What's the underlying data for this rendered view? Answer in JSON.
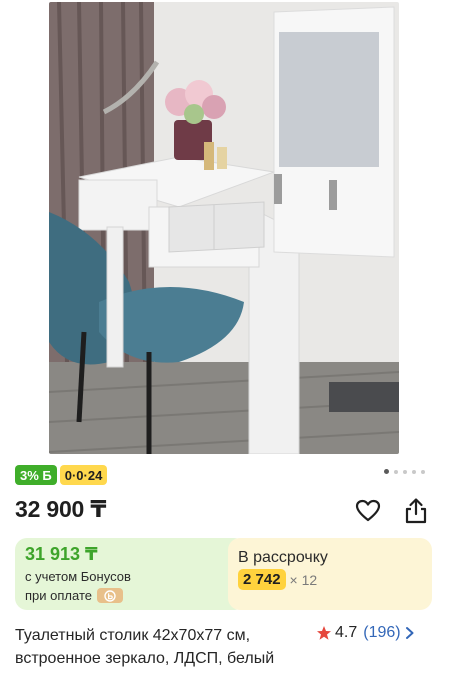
{
  "product": {
    "badge_bonus": "3% Б",
    "badge_installment": "0·0·24",
    "price": "32 900 ₸",
    "title": "Туалетный столик 42х70х77 см, встроенное зеркало, ЛДСП, белый",
    "rating": "4.7",
    "reviews": "(196)"
  },
  "gallery": {
    "image_count": 5,
    "active_index": 0
  },
  "bonus_card": {
    "amount": "31 913 ₸",
    "line1": "с учетом Бонусов",
    "line2": "при оплате"
  },
  "installment_card": {
    "title": "В рассрочку",
    "monthly": "2 742",
    "months": "× 12"
  },
  "icons": [
    "heart-icon",
    "share-icon",
    "star-icon",
    "chevron-right-icon",
    "kaspi-b-icon"
  ],
  "colors": {
    "bonus_green": "#3fae2a",
    "installment_yellow": "#ffd84d",
    "rating_star": "#e5473d",
    "link_blue": "#3367b8"
  }
}
